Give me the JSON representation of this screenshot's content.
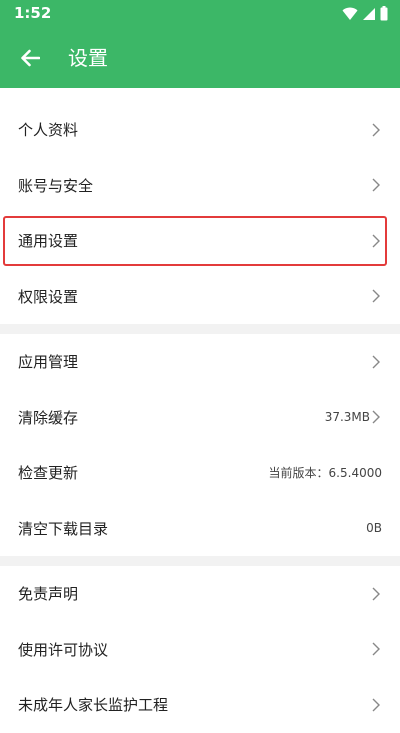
{
  "status": {
    "time": "1:52",
    "icons": [
      "wifi-icon",
      "signal-icon",
      "battery-icon"
    ]
  },
  "appbar": {
    "title": "设置",
    "back_icon": "back-arrow-icon"
  },
  "colors": {
    "primary": "#3cb767",
    "highlight": "#e33b3b",
    "divider": "#f2f2f2"
  },
  "groups": [
    {
      "items": [
        {
          "label": "个人资料"
        },
        {
          "label": "账号与安全"
        },
        {
          "label": "通用设置",
          "highlighted": true
        },
        {
          "label": "权限设置"
        }
      ]
    },
    {
      "items": [
        {
          "label": "应用管理"
        },
        {
          "label": "清除缓存",
          "value": "37.3MB"
        },
        {
          "label": "检查更新",
          "value": "当前版本：6.5.4000"
        },
        {
          "label": "清空下载目录",
          "value": "0B"
        }
      ]
    },
    {
      "items": [
        {
          "label": "免责声明"
        },
        {
          "label": "使用许可协议"
        },
        {
          "label": "未成年人家长监护工程"
        }
      ]
    }
  ]
}
